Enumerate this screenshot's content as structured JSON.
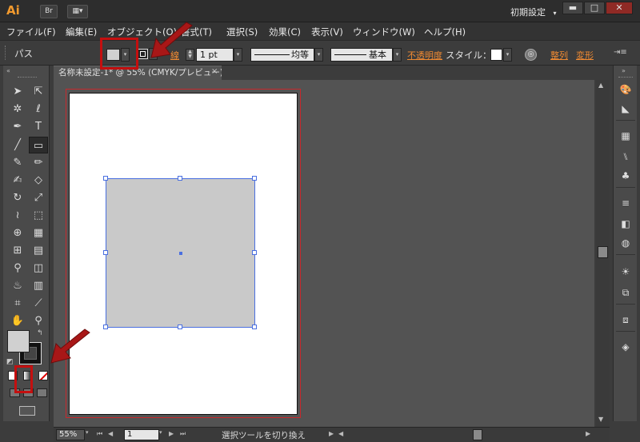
{
  "app": {
    "logo": "Ai",
    "bridge_button": "Br",
    "arrange_button": "▦▾",
    "workspace": "初期設定",
    "workspace_arrow": "▾",
    "window_controls": {
      "minimize": "▬",
      "restore": "□",
      "close": "✕"
    }
  },
  "menu": {
    "items": [
      "ファイル(F)",
      "編集(E)",
      "オブジェクト(O)",
      "書式(T)",
      "選択(S)",
      "効果(C)",
      "表示(V)",
      "ウィンドウ(W)",
      "ヘルプ(H)"
    ]
  },
  "control_bar": {
    "selection_type": "パス",
    "stroke_label": "線",
    "stroke_weight": "1 pt",
    "stroke_profile": "均等",
    "brush": "基本",
    "opacity_link": "不透明度",
    "style_label": "スタイル：",
    "align_link": "整列",
    "transform_link": "変形"
  },
  "document": {
    "tab_title": "名称未設定-1* @ 55% (CMYK/プレビュー)",
    "tab_close": "×"
  },
  "status_bar": {
    "zoom": "55%",
    "artboard_number": "1",
    "status_text": "選択ツールを切り換え"
  },
  "colors": {
    "accent": "#f08a32",
    "annotation_red": "#c40f0f",
    "selection_blue": "#4a6fe0",
    "fill": "#c9c9c9"
  },
  "icons": {
    "tools": [
      "selection-tool-icon",
      "direct-selection-tool-icon",
      "magic-wand-tool-icon",
      "lasso-tool-icon",
      "pen-tool-icon",
      "type-tool-icon",
      "line-segment-tool-icon",
      "rectangle-tool-icon",
      "paintbrush-tool-icon",
      "pencil-tool-icon",
      "blob-brush-tool-icon",
      "eraser-tool-icon",
      "rotate-tool-icon",
      "scale-tool-icon",
      "width-tool-icon",
      "free-transform-tool-icon",
      "shape-builder-tool-icon",
      "perspective-grid-tool-icon",
      "mesh-tool-icon",
      "gradient-tool-icon",
      "eyedropper-tool-icon",
      "blend-tool-icon",
      "symbol-sprayer-tool-icon",
      "column-graph-tool-icon",
      "artboard-tool-icon",
      "slice-tool-icon",
      "hand-tool-icon",
      "zoom-tool-icon"
    ]
  }
}
